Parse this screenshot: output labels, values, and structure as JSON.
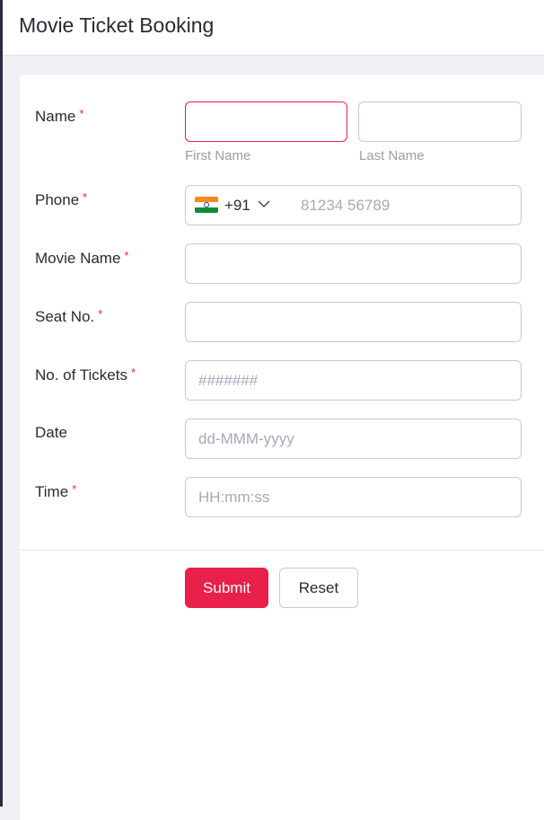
{
  "header": {
    "title": "Movie Ticket Booking"
  },
  "form": {
    "name": {
      "label": "Name",
      "required_mark": "*",
      "first_value": "",
      "last_value": "",
      "first_sublabel": "First Name",
      "last_sublabel": "Last Name"
    },
    "phone": {
      "label": "Phone",
      "required_mark": "*",
      "country_code": "+91",
      "country_flag": "india-flag-icon",
      "placeholder": "81234 56789"
    },
    "movie_name": {
      "label": "Movie Name",
      "required_mark": "*",
      "value": ""
    },
    "seat_no": {
      "label": "Seat No.",
      "required_mark": "*",
      "value": ""
    },
    "tickets": {
      "label": "No. of Tickets",
      "required_mark": "*",
      "placeholder": "#######"
    },
    "date": {
      "label": "Date",
      "placeholder": "dd-MMM-yyyy"
    },
    "time": {
      "label": "Time",
      "required_mark": "*",
      "placeholder": "HH:mm:ss"
    }
  },
  "actions": {
    "submit_label": "Submit",
    "reset_label": "Reset"
  },
  "colors": {
    "accent": "#e8204a",
    "sidebar": "#2b2a45",
    "background": "#efeff4"
  }
}
